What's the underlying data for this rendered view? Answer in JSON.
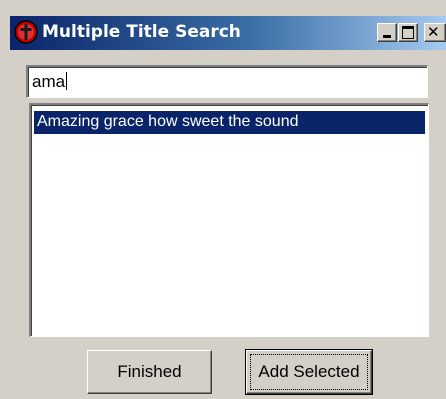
{
  "window": {
    "title": "Multiple Title Search",
    "icon": "cross-circle-icon"
  },
  "titlebar_buttons": {
    "minimize": "minimize-icon",
    "maximize": "maximize-icon",
    "close": "close-icon"
  },
  "search": {
    "value": "ama"
  },
  "results": {
    "items": [
      {
        "label": "Amazing grace how sweet the sound",
        "selected": true
      }
    ]
  },
  "buttons": {
    "finished": "Finished",
    "add_selected": "Add Selected"
  },
  "colors": {
    "titlebar_start": "#0a246a",
    "titlebar_end": "#a6caf0",
    "selection": "#0a246a",
    "face": "#d4d0c8"
  }
}
